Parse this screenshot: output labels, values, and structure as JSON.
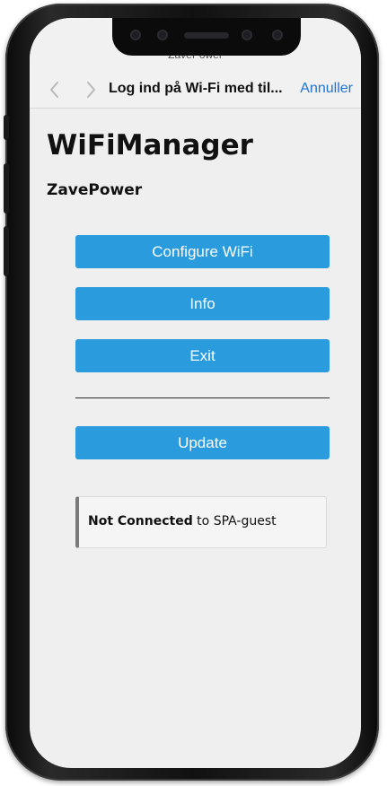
{
  "browser": {
    "site_name": "ZavePower",
    "sheet_title": "Log ind på Wi-Fi med til...",
    "cancel_label": "Annuller",
    "back_icon": "chevron-left-icon",
    "forward_icon": "chevron-right-icon"
  },
  "page": {
    "title": "WiFiManager",
    "subtitle": "ZavePower",
    "buttons": {
      "configure": "Configure WiFi",
      "info": "Info",
      "exit": "Exit",
      "update": "Update"
    },
    "status": {
      "state": "Not Connected",
      "rest": " to SPA-guest"
    }
  },
  "colors": {
    "button_bg": "#2a9cde",
    "link": "#1f74d8",
    "status_border": "#7a7a7a"
  }
}
